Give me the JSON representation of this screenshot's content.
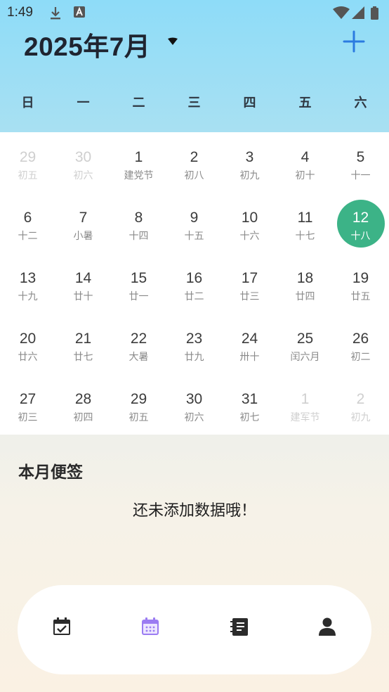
{
  "status_bar": {
    "time": "1:49",
    "icons": [
      "download-icon",
      "a-letter-icon",
      "wifi-icon",
      "signal-icon",
      "battery-icon"
    ]
  },
  "header": {
    "month_title": "2025年7月",
    "dropdown_icon": "caret-down-icon",
    "add_icon": "plus-icon",
    "accent_color": "#2b7be0"
  },
  "weekdays": [
    "日",
    "一",
    "二",
    "三",
    "四",
    "五",
    "六"
  ],
  "calendar": {
    "selected_color": "#3cb387",
    "weeks": [
      [
        {
          "day": "29",
          "lunar": "初五",
          "other": true
        },
        {
          "day": "30",
          "lunar": "初六",
          "other": true
        },
        {
          "day": "1",
          "lunar": "建党节"
        },
        {
          "day": "2",
          "lunar": "初八"
        },
        {
          "day": "3",
          "lunar": "初九"
        },
        {
          "day": "4",
          "lunar": "初十"
        },
        {
          "day": "5",
          "lunar": "十一"
        }
      ],
      [
        {
          "day": "6",
          "lunar": "十二"
        },
        {
          "day": "7",
          "lunar": "小暑"
        },
        {
          "day": "8",
          "lunar": "十四"
        },
        {
          "day": "9",
          "lunar": "十五"
        },
        {
          "day": "10",
          "lunar": "十六"
        },
        {
          "day": "11",
          "lunar": "十七"
        },
        {
          "day": "12",
          "lunar": "十八",
          "selected": true
        }
      ],
      [
        {
          "day": "13",
          "lunar": "十九"
        },
        {
          "day": "14",
          "lunar": "廿十"
        },
        {
          "day": "15",
          "lunar": "廿一"
        },
        {
          "day": "16",
          "lunar": "廿二"
        },
        {
          "day": "17",
          "lunar": "廿三"
        },
        {
          "day": "18",
          "lunar": "廿四"
        },
        {
          "day": "19",
          "lunar": "廿五"
        }
      ],
      [
        {
          "day": "20",
          "lunar": "廿六"
        },
        {
          "day": "21",
          "lunar": "廿七"
        },
        {
          "day": "22",
          "lunar": "大暑"
        },
        {
          "day": "23",
          "lunar": "廿九"
        },
        {
          "day": "24",
          "lunar": "卅十"
        },
        {
          "day": "25",
          "lunar": "闰六月"
        },
        {
          "day": "26",
          "lunar": "初二"
        }
      ],
      [
        {
          "day": "27",
          "lunar": "初三"
        },
        {
          "day": "28",
          "lunar": "初四"
        },
        {
          "day": "29",
          "lunar": "初五"
        },
        {
          "day": "30",
          "lunar": "初六"
        },
        {
          "day": "31",
          "lunar": "初七"
        },
        {
          "day": "1",
          "lunar": "建军节",
          "other": true
        },
        {
          "day": "2",
          "lunar": "初九",
          "other": true
        }
      ]
    ]
  },
  "notes": {
    "title": "本月便签",
    "empty_text": "还未添加数据哦！"
  },
  "bottom_nav": {
    "items": [
      {
        "icon": "calendar-check-icon",
        "active": false
      },
      {
        "icon": "calendar-icon",
        "active": true
      },
      {
        "icon": "notebook-icon",
        "active": false
      },
      {
        "icon": "user-icon",
        "active": false
      }
    ],
    "active_color": "#9b7cf2",
    "inactive_color": "#2b2b2b"
  }
}
